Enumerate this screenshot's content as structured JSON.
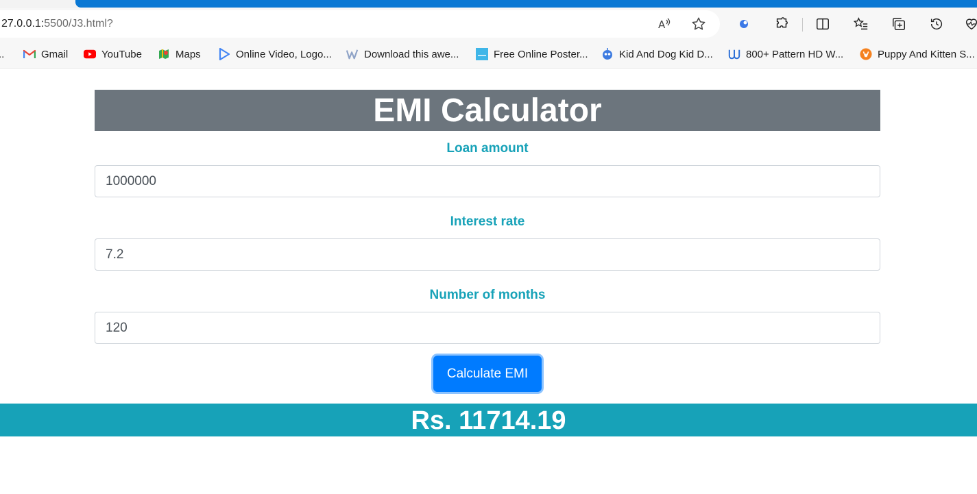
{
  "browser": {
    "url_host": "27.0.0.1:",
    "url_rest": "5500/J3.html?",
    "accent_color": "#0a78d4",
    "toolbar_icons": [
      "read-aloud-icon",
      "favorite-star-icon",
      "extension-dot-icon",
      "extensions-puzzle-icon",
      "split-screen-icon",
      "favorites-list-icon",
      "collections-icon",
      "history-icon",
      "heartbeat-icon"
    ]
  },
  "bookmarks": [
    {
      "label": "Gmail",
      "icon": "gmail-icon",
      "color": "#ea4335"
    },
    {
      "label": "YouTube",
      "icon": "youtube-icon",
      "color": "#ff0000"
    },
    {
      "label": "Maps",
      "icon": "maps-icon",
      "color": "#34a853"
    },
    {
      "label": "Online Video, Logo...",
      "icon": "play-icon",
      "color": "#4285f4"
    },
    {
      "label": "Download this awe...",
      "icon": "w-logo-icon",
      "color": "#8fa3c7"
    },
    {
      "label": "Free Online Poster...",
      "icon": "poster-icon",
      "color": "#3fb6e8"
    },
    {
      "label": "Kid And Dog Kid D...",
      "icon": "robot-icon",
      "color": "#3d7be0"
    },
    {
      "label": "800+ Pattern HD W...",
      "icon": "pattern-w-icon",
      "color": "#2b6fd6"
    },
    {
      "label": "Puppy And Kitten S...",
      "icon": "puppy-icon",
      "color": "#f5821f"
    }
  ],
  "page": {
    "title": "EMI Calculator",
    "fields": [
      {
        "label": "Loan amount",
        "value": "1000000"
      },
      {
        "label": "Interest rate",
        "value": "7.2"
      },
      {
        "label": "Number of months",
        "value": "120"
      }
    ],
    "button_label": "Calculate EMI",
    "result": "Rs. 11714.19",
    "colors": {
      "heading_bg": "#6c757d",
      "label": "#17a2b8",
      "button": "#007bff",
      "result_bg": "#17a2b8"
    }
  }
}
